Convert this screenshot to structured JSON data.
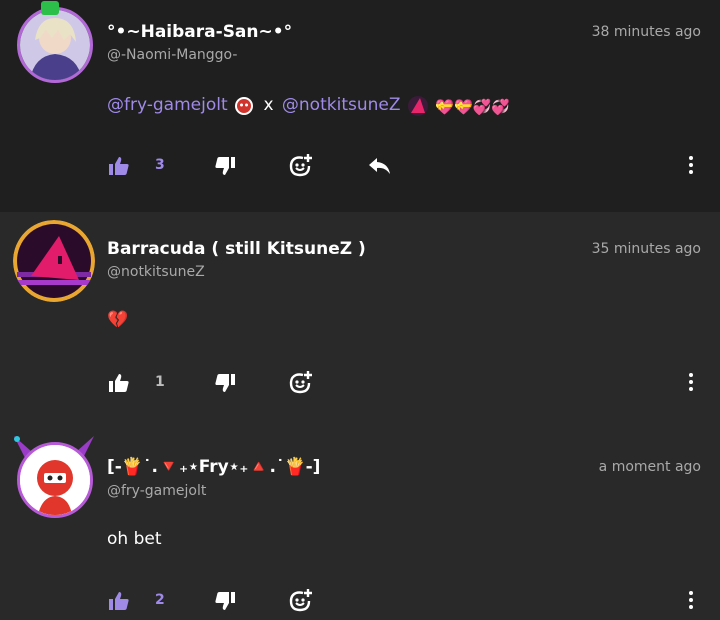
{
  "comments": [
    {
      "display_name": "°•~Haibara-San~•°",
      "username": "@-Naomi-Manggo-",
      "time": "38 minutes ago",
      "body": {
        "mention1": "@fry-gamejolt",
        "separator": "x",
        "mention2": "@notkitsuneZ",
        "hearts": "💝💝💞💞"
      },
      "likes": "3",
      "liked": true
    },
    {
      "display_name": "Barracuda ( still KitsuneZ )",
      "username": "@notkitsuneZ",
      "time": "35 minutes ago",
      "body": "💔",
      "likes": "1",
      "liked": false
    },
    {
      "display_name": "[-🍟˙.🔻₊⋆Fry⋆₊🔺.˙🍟-]",
      "username": "@fry-gamejolt",
      "time": "a moment ago",
      "body": "oh bet",
      "likes": "2",
      "liked": true
    }
  ],
  "icons": [
    "thumbs-up-icon",
    "thumbs-down-icon",
    "add-reaction-icon",
    "reply-icon",
    "more-vertical-icon"
  ],
  "colors": {
    "accent": "#9f8ae8",
    "background": "#292929",
    "highlight_background": "#1f1f1f",
    "muted_text": "#a9a9a9"
  }
}
